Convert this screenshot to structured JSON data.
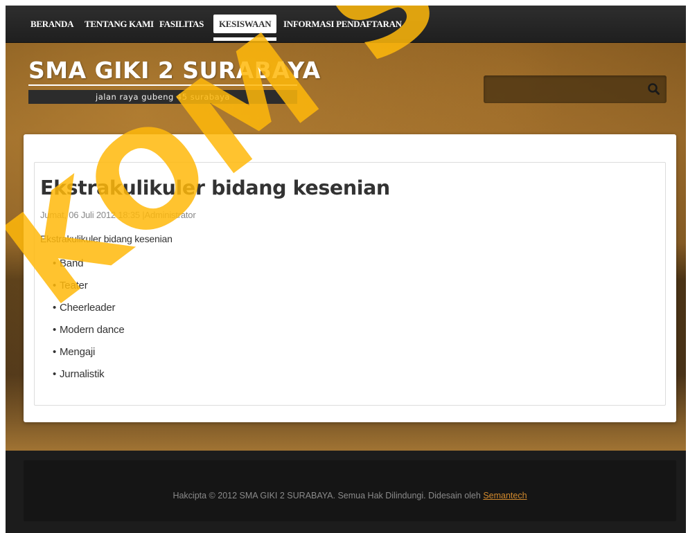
{
  "nav": {
    "items": [
      {
        "label": "BERANDA"
      },
      {
        "label": "TENTANG KAMI"
      },
      {
        "label": "FASILITAS"
      },
      {
        "label": "KESISWAAN"
      },
      {
        "label": "INFORMASI PENDAFTARAN"
      }
    ],
    "active": "KESISWAAN"
  },
  "header": {
    "site_title": "SMA GIKI 2 SURABAYA",
    "tagline": "jalan raya gubeng 45 surabaya"
  },
  "search": {
    "placeholder": "",
    "icon": "search-icon"
  },
  "article": {
    "title": "Ekstrakulikuler bidang kesenian",
    "meta": "Jumat, 06 Juli 2012 18:35  |Administrator",
    "intro": "Ekstrakulikuler bidang kesenian",
    "items": [
      "Band",
      "Teater",
      "Cheerleader",
      "Modern dance",
      "Mengaji",
      "Jurnalistik"
    ]
  },
  "footer": {
    "text": "Hakcipta © 2012 SMA GIKI 2 SURABAYA. Semua Hak Dilindungi. Didesain oleh ",
    "link_label": "Semantech"
  },
  "watermark": {
    "text": "KOM SURA"
  },
  "colors": {
    "nav_bg": "#2a2a2a",
    "accent_link": "#d28a2e",
    "watermark": "#ffb90a",
    "footer_bg": "#1c1c1c"
  }
}
